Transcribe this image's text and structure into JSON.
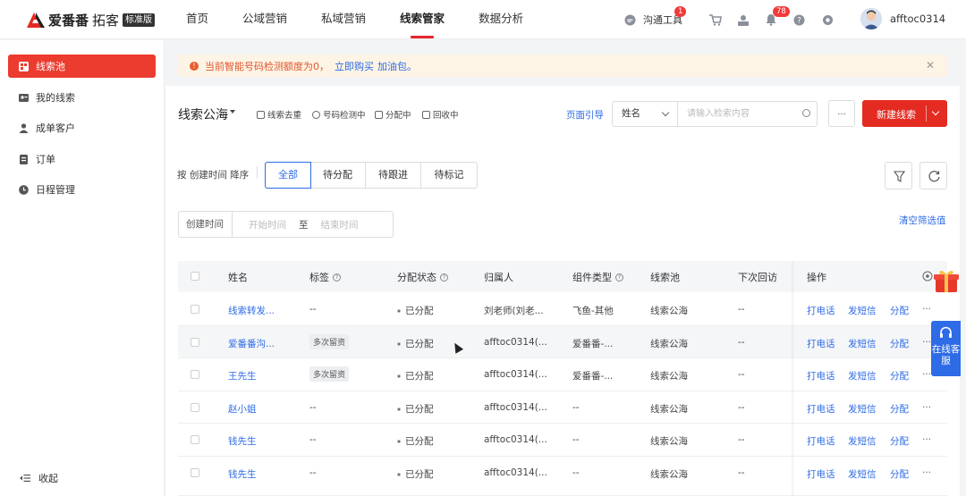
{
  "brand": {
    "name": "爱番番",
    "sub": "拓客",
    "badge": "标准版"
  },
  "nav": [
    "首页",
    "公域营销",
    "私域营销",
    "线索管家",
    "数据分析"
  ],
  "toolbar": {
    "chat_label": "沟通工具",
    "chat_badge": "1",
    "bell_badge": "78",
    "username": "afftoc0314"
  },
  "sidebar": {
    "items": [
      {
        "label": "线索池"
      },
      {
        "label": "我的线索"
      },
      {
        "label": "成单客户"
      },
      {
        "label": "订单"
      },
      {
        "label": "日程管理"
      }
    ],
    "collapse_label": "收起"
  },
  "notice": {
    "text": "当前智能号码检测额度为0，",
    "link1": "立即购买",
    "link2": "加油包。"
  },
  "header": {
    "title": "线索公海",
    "actions": [
      "线索去重",
      "号码检测中",
      "分配中",
      "回收中"
    ],
    "guide": "页面引导",
    "select_value": "姓名",
    "search_placeholder": "请输入检索内容",
    "more_label": "...",
    "new_label": "新建线索"
  },
  "filter": {
    "sort_text": "按 创建时间 降序",
    "tabs": [
      "全部",
      "待分配",
      "待跟进",
      "待标记"
    ],
    "date_label": "创建时间",
    "date_start": "开始时间",
    "date_to": "至",
    "date_end": "结束时间",
    "clear_label": "清空筛选值"
  },
  "table": {
    "columns": [
      "姓名",
      "标签",
      "分配状态",
      "归属人",
      "组件类型",
      "线索池",
      "下次回访",
      "操作"
    ],
    "rows": [
      {
        "name": "线索转发...",
        "tag": "--",
        "status": "已分配",
        "owner": "刘老师(刘老...",
        "type": "飞鱼-其他",
        "pool": "线索公海",
        "next": "--"
      },
      {
        "name": "爱番番沟...",
        "tag": "多次留资",
        "status": "已分配",
        "owner": "afftoc0314(...",
        "type": "爱番番-...",
        "pool": "线索公海",
        "next": "--"
      },
      {
        "name": "王先生",
        "tag": "多次留资",
        "status": "已分配",
        "owner": "afftoc0314(...",
        "type": "爱番番-...",
        "pool": "线索公海",
        "next": "--"
      },
      {
        "name": "赵小姐",
        "tag": "--",
        "status": "已分配",
        "owner": "afftoc0314(...",
        "type": "--",
        "pool": "线索公海",
        "next": "--"
      },
      {
        "name": "钱先生",
        "tag": "--",
        "status": "已分配",
        "owner": "afftoc0314(...",
        "type": "--",
        "pool": "线索公海",
        "next": "--"
      },
      {
        "name": "钱先生",
        "tag": "--",
        "status": "已分配",
        "owner": "afftoc0314(...",
        "type": "--",
        "pool": "线索公海",
        "next": "--"
      }
    ],
    "ops": [
      "打电话",
      "发短信",
      "分配"
    ],
    "op_more": "···"
  },
  "float": {
    "cs_label": "在线客服"
  },
  "colors": {
    "brand_red": "#e42b21",
    "link_blue": "#2e6be6"
  }
}
